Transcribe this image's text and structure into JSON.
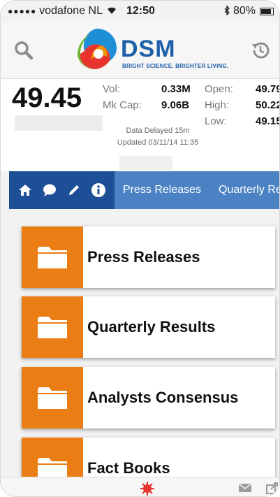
{
  "status_bar": {
    "signal": "●●●●●",
    "carrier": "vodafone NL",
    "wifi": "wifi-icon",
    "time": "12:50",
    "bluetooth": "bluetooth-icon",
    "battery_percent": "80%"
  },
  "header": {
    "brand_name": "DSM",
    "tagline": "BRIGHT SCIENCE. BRIGHTER LIVING.",
    "left_icon": "search-icon",
    "right_icon": "history-icon"
  },
  "stock": {
    "price": "49.45",
    "vol_label": "Vol:",
    "vol_value": "0.33M",
    "mkcap_label": "Mk Cap:",
    "mkcap_value": "9.06B",
    "open_label": "Open:",
    "open_value": "49.79",
    "high_label": "High:",
    "high_value": "50.22",
    "low_label": "Low:",
    "low_value": "49.15",
    "delay_text": "Data Delayed 15m",
    "updated_text": "Updated 03/11/14 11:35"
  },
  "nav": {
    "icons": [
      "home-icon",
      "chat-icon",
      "pencil-icon",
      "info-icon"
    ],
    "tabs": [
      {
        "label": "Press Releases"
      },
      {
        "label": "Quarterly Results"
      }
    ]
  },
  "cards": [
    {
      "label": "Press Releases",
      "icon": "folder-icon"
    },
    {
      "label": "Quarterly Results",
      "icon": "folder-icon"
    },
    {
      "label": "Analysts Consensus",
      "icon": "folder-icon"
    },
    {
      "label": "Fact Books",
      "icon": "folder-icon"
    }
  ],
  "bottom_bar": {
    "icons": [
      "brand-emblem-icon",
      "mail-icon",
      "share-icon"
    ]
  },
  "colors": {
    "accent_orange": "#ea7d14",
    "nav_dark_blue": "#1c4f96",
    "nav_light_blue": "#4a82c3",
    "brand_blue": "#1d5fa8"
  }
}
